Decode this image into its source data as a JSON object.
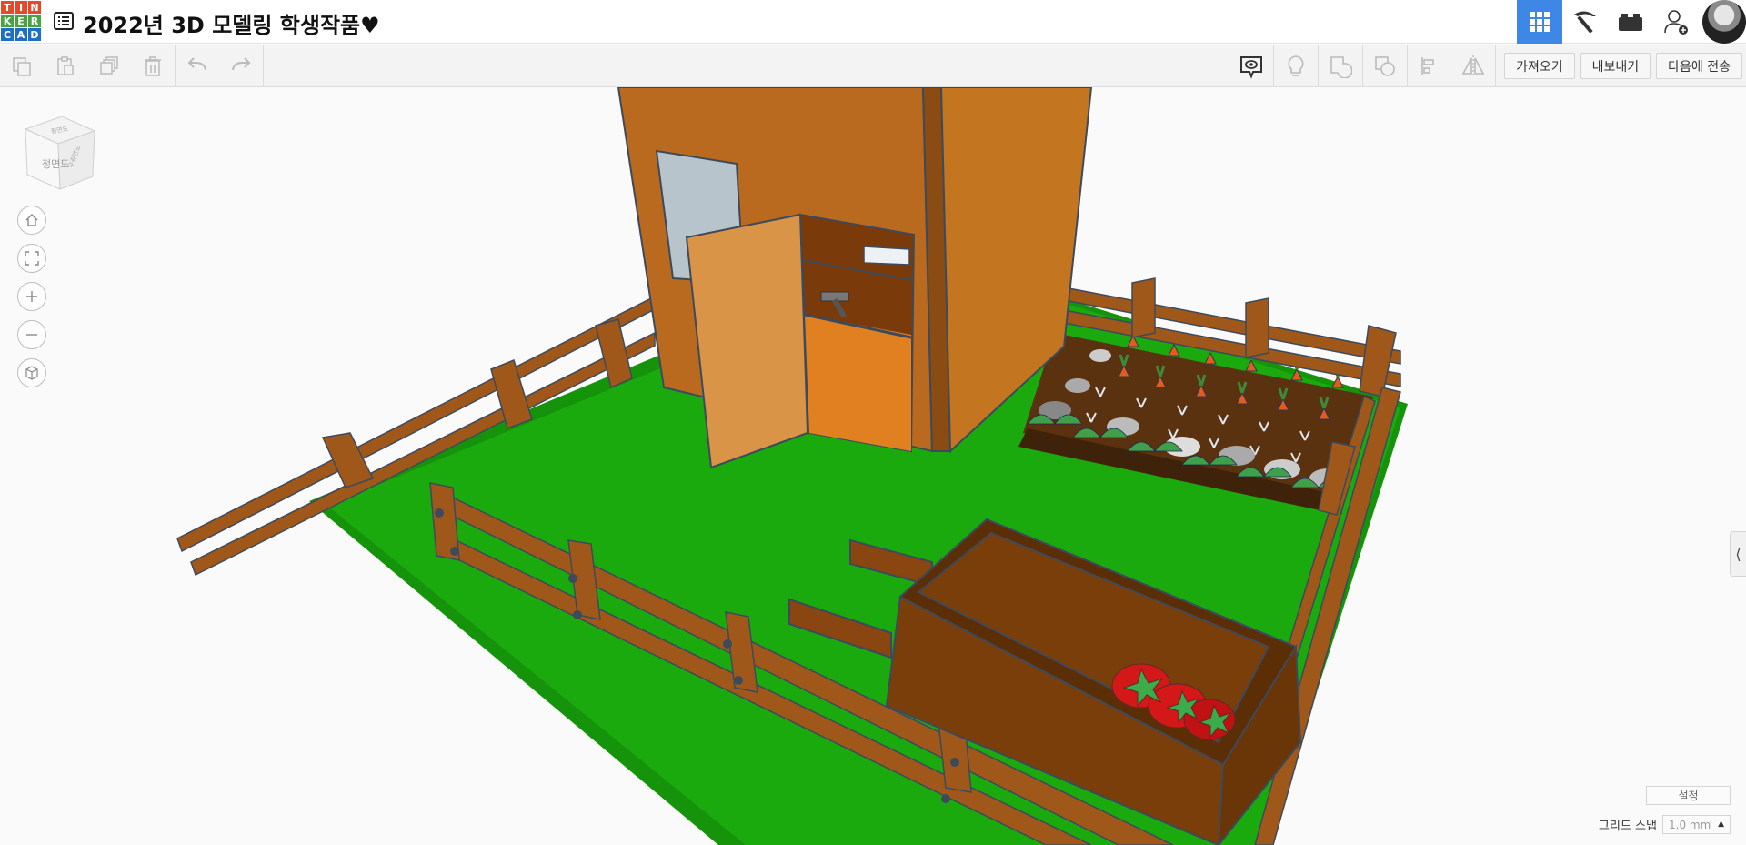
{
  "logo": {
    "letters": [
      "T",
      "I",
      "N",
      "K",
      "E",
      "R",
      "C",
      "A",
      "D"
    ],
    "colors": [
      "#e8472c",
      "#e8472c",
      "#e8472c",
      "#48a343",
      "#48a343",
      "#48a343",
      "#1e6fc4",
      "#1e6fc4",
      "#1e6fc4"
    ]
  },
  "project": {
    "title": "2022년 3D 모델링 학생작품♥"
  },
  "header": {
    "buttons": [
      "3d-design-view",
      "codeblocks",
      "bricks",
      "invite-user"
    ],
    "accent": "#3f87e6"
  },
  "toolbar": {
    "import_label": "가져오기",
    "export_label": "내보내기",
    "send_label": "다음에 전송"
  },
  "viewcube": {
    "face_label": "정면도",
    "top_label": "평면도",
    "side_label": "우측면도"
  },
  "workplane": {
    "settings_label": "설정",
    "snap_label": "그리드 스냅",
    "snap_value": "1.0 mm",
    "colors": {
      "ground": "#1aaa0d",
      "wood": "#a0581a",
      "house": "#b96a1e",
      "soil": "#5a3210"
    }
  }
}
